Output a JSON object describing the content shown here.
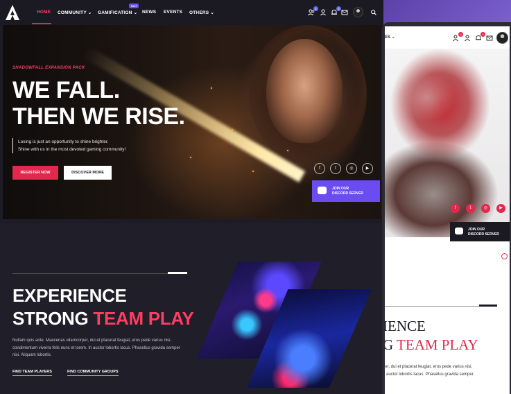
{
  "nav": {
    "items": [
      {
        "label": "HOME",
        "has_dropdown": false,
        "active": true
      },
      {
        "label": "COMMUNITY",
        "has_dropdown": true,
        "active": false
      },
      {
        "label": "GAMIFICATION",
        "has_dropdown": true,
        "active": false
      },
      {
        "label": "NEWS",
        "has_dropdown": false,
        "active": false
      },
      {
        "label": "EVENTS",
        "has_dropdown": false,
        "active": false
      },
      {
        "label": "OTHERS",
        "has_dropdown": true,
        "active": false
      }
    ],
    "hot_badge": "HOT",
    "icons": [
      "users-icon",
      "user-icon",
      "bell-icon",
      "mail-icon",
      "avatar",
      "search-icon"
    ],
    "badge_counts": {
      "users": "4",
      "bell": "4"
    }
  },
  "hero": {
    "tag": "SHADOWFALL EXPANSION PACK",
    "title_line1": "WE FALL.",
    "title_line2": "THEN WE RISE.",
    "desc_line1": "Losing is just an opportunity to shine brighter.",
    "desc_line2": "Shine with us in the most devoted gaming community!",
    "register_label": "REGISTER NOW",
    "discover_label": "DISCOVER MORE",
    "social_icons": [
      "facebook-icon",
      "twitter-icon",
      "instagram-icon",
      "youtube-icon"
    ],
    "discord_line1": "JOIN OUR",
    "discord_line2": "DISCORD SERVER"
  },
  "section2": {
    "title_line1": "EXPERIENCE",
    "title_line2_plain": "STRONG ",
    "title_line2_accent": "TEAM PLAY",
    "desc_line1": "Nullam quis ante. Maecenas ullamcorper, dui et placerat feugiat, eros pede varius nisi,",
    "desc_line2": "condimentum viverra felis nunc et lorem. In auctor lobortis lacus. Phasellus gravida semper",
    "desc_line3": "nisi. Aliquam lobortis.",
    "link1": "FIND TEAM PLAYERS",
    "link2": "FIND COMMUNITY GROUPS"
  },
  "mobile": {
    "nav_partial": "ES",
    "badge_counts": {
      "users": "3",
      "bell": "4"
    },
    "discord_line1": "JOIN OUR",
    "discord_line2": "DISCORD SERVER",
    "title_line1": "IENCE",
    "title_line2_plain": "G ",
    "title_line2_accent": "TEAM PLAY",
    "desc_line1": "ger, dui et placerat feugiat, eros pede varius nisi,",
    "desc_line2": "n auctor lobortis lacus. Phasellus gravida semper"
  },
  "colors": {
    "accent": "#e3284e",
    "discord": "#6b4cf0",
    "nav_bg": "#1b1a23",
    "section_bg": "#1f1e29"
  }
}
